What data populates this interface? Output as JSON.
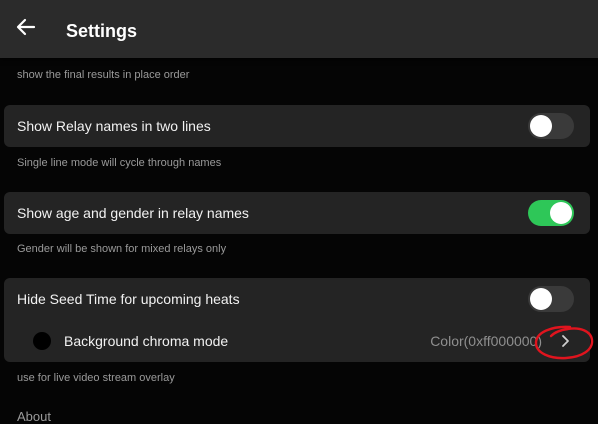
{
  "appbar": {
    "back_icon": "arrow-left-icon",
    "title": "Settings"
  },
  "settings": {
    "results_caption": "show the final results in place order",
    "relay_two_lines": {
      "label": "Show Relay names in two lines",
      "enabled": false,
      "caption": "Single line mode will cycle through names"
    },
    "age_gender": {
      "label": "Show age and gender in relay names",
      "enabled": true,
      "caption": "Gender will be shown for mixed relays only"
    },
    "hide_seed": {
      "label": "Hide Seed Time for upcoming heats",
      "enabled": false
    },
    "chroma": {
      "label": "Background chroma mode",
      "value": "Color(0xff000000)",
      "chevron_icon": "chevron-right-icon",
      "caption": "use for live video stream overlay"
    },
    "about_heading": "About"
  },
  "colors": {
    "toggle_on": "#2ec758",
    "annotation": "#e0141e"
  }
}
